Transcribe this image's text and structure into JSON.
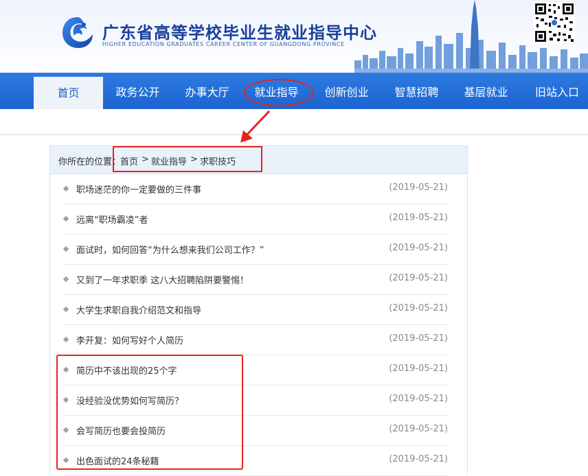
{
  "header": {
    "title": "广东省高等学校毕业生就业指导中心",
    "subtitle": "HIGHER EDUCATION GRADUATES CAREER CENTER OF GUANGDONG PROVINCE",
    "brand_color": "#1a3e9c",
    "logo_icon": "guangdong-career-logo",
    "qr_icon": "qr-code"
  },
  "nav": {
    "items": [
      {
        "label": "首页",
        "active": true
      },
      {
        "label": "政务公开"
      },
      {
        "label": "办事大厅"
      },
      {
        "label": "就业指导"
      },
      {
        "label": "创新创业"
      },
      {
        "label": "智慧招聘"
      },
      {
        "label": "基层就业"
      },
      {
        "label": "旧站入口"
      }
    ],
    "color": "#1f6ad8"
  },
  "breadcrumb": {
    "prefix": "你所在的位置：",
    "home": "首页",
    "sep": ">",
    "level1": "就业指导",
    "level2": "求职技巧"
  },
  "articles": [
    {
      "title": "职场迷茫的你一定要做的三件事",
      "date": "(2019-05-21)"
    },
    {
      "title": "远离“职场霸凌”者",
      "date": "(2019-05-21)"
    },
    {
      "title": "面试时，如何回答“为什么想来我们公司工作？”",
      "date": "(2019-05-21)"
    },
    {
      "title": "又到了一年求职季 这八大招聘陷阱要警惕！",
      "date": "(2019-05-21)"
    },
    {
      "title": "大学生求职自我介绍范文和指导",
      "date": "(2019-05-21)"
    },
    {
      "title": "李开复：如何写好个人简历",
      "date": "(2019-05-21)"
    },
    {
      "title": "简历中不该出现的25个字",
      "date": "(2019-05-21)"
    },
    {
      "title": "没经验没优势如何写简历？",
      "date": "(2019-05-21)"
    },
    {
      "title": "会写简历也要会投简历",
      "date": "(2019-05-21)"
    },
    {
      "title": "出色面试的24条秘籍",
      "date": "(2019-05-21)"
    }
  ],
  "annotation_color": "#e8221e"
}
